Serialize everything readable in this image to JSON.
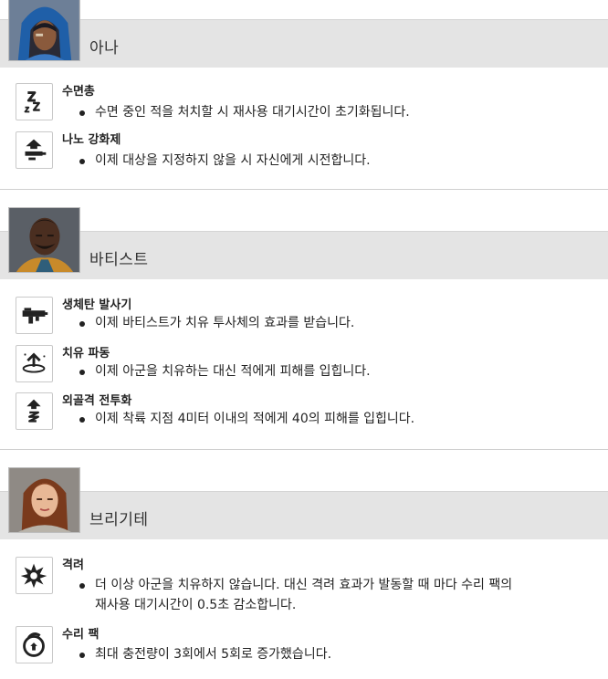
{
  "heroes": [
    {
      "name": "아나",
      "portrait_icon": "ana-portrait",
      "abilities": [
        {
          "icon": "sleep-dart-icon",
          "title": "수면총",
          "lines": [
            "수면 중인 적을 처치할 시 재사용 대기시간이 초기화됩니다."
          ]
        },
        {
          "icon": "nano-boost-icon",
          "title": "나노 강화제",
          "lines": [
            "이제 대상을 지정하지 않을 시 자신에게 시전합니다."
          ]
        }
      ]
    },
    {
      "name": "바티스트",
      "portrait_icon": "baptiste-portrait",
      "abilities": [
        {
          "icon": "biotic-launcher-icon",
          "title": "생체탄 발사기",
          "lines": [
            "이제 바티스트가 치유 투사체의 효과를 받습니다."
          ]
        },
        {
          "icon": "regenerative-burst-icon",
          "title": "치유 파동",
          "lines": [
            "이제 아군을 치유하는 대신 적에게 피해를 입힙니다."
          ]
        },
        {
          "icon": "exo-boots-icon",
          "title": "외골격 전투화",
          "lines": [
            "이제 착륙 지점 4미터 이내의 적에게 40의 피해를 입힙니다."
          ]
        }
      ]
    },
    {
      "name": "브리기테",
      "portrait_icon": "brigitte-portrait",
      "abilities": [
        {
          "icon": "inspire-icon",
          "title": "격려",
          "lines": [
            "더 이상 아군을 치유하지 않습니다. 대신 격려 효과가 발동할 때 마다 수리 팩의",
            "재사용 대기시간이 0.5초 감소합니다."
          ]
        },
        {
          "icon": "repair-pack-icon",
          "title": "수리 팩",
          "lines": [
            "최대 충전량이 3회에서 5회로 증가했습니다."
          ]
        }
      ]
    }
  ]
}
